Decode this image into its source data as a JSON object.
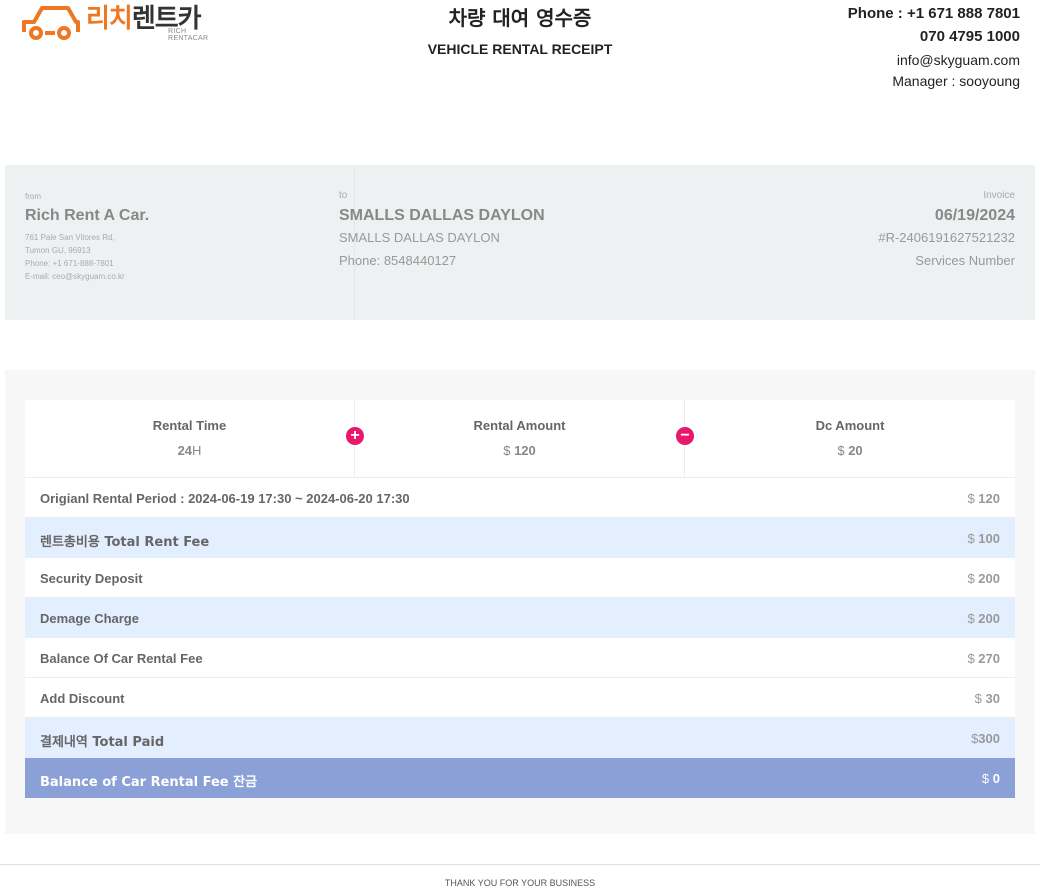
{
  "logo": {
    "ko_part1": "리치",
    "ko_part2": "렌트카",
    "en": "RICH RENTACAR",
    "icon": "car-logo-icon"
  },
  "title": {
    "ko": "차량 대여 영수증",
    "en": "VEHICLE RENTAL RECEIPT"
  },
  "contact": {
    "phone": "Phone : +1 671 888 7801",
    "phone2": "070 4795 1000",
    "email": "info@skyguam.com",
    "manager": "Manager : sooyoung"
  },
  "from": {
    "label": "from",
    "name": "Rich Rent A Car.",
    "address1": "761 Pale San Vitores Rd,",
    "address2": "Tumon GU, 96913",
    "phone": "Phone: +1 671-888-7801",
    "email": "E-mail: ceo@skyguam.co.kr"
  },
  "to": {
    "label": "to",
    "name": "SMALLS DALLAS DAYLON",
    "name2": "SMALLS DALLAS DAYLON",
    "phone": "Phone: 8548440127"
  },
  "invoice": {
    "label": "Invoice",
    "date": "06/19/2024",
    "number": "#R-2406191627521232",
    "services": "Services Number"
  },
  "summary": {
    "rental_time_label": "Rental Time",
    "rental_time_value": "24",
    "rental_time_unit": "H",
    "rental_amount_label": "Rental Amount",
    "rental_amount_currency": "$",
    "rental_amount_value": "120",
    "dc_amount_label": "Dc Amount",
    "dc_amount_currency": "$",
    "dc_amount_value": "20",
    "plus_symbol": "+",
    "minus_symbol": "−"
  },
  "rows": [
    {
      "label": "Origianl Rental Period : 2024-06-19 17:30 ~ 2024-06-20 17:30",
      "currency": "$",
      "amount": "120"
    },
    {
      "label": "렌트총비용 Total Rent Fee",
      "currency": "$",
      "amount": "100"
    },
    {
      "label": "Security Deposit",
      "currency": "$",
      "amount": "200"
    },
    {
      "label": "Demage Charge",
      "currency": "$",
      "amount": "200"
    },
    {
      "label": "Balance Of Car Rental Fee",
      "currency": "$",
      "amount": "270"
    },
    {
      "label": "Add Discount",
      "currency": "$",
      "amount": "30"
    },
    {
      "label": "결제내역 Total Paid",
      "currency": "$",
      "amount": "300"
    },
    {
      "label": "Balance of Car Rental Fee 잔금",
      "currency": "$",
      "amount": "0"
    }
  ],
  "footer": "THANK YOU FOR YOUR BUSINESS",
  "colors": {
    "brand_orange": "#ee7722",
    "accent_pink": "#e8196d",
    "row_blue": "#e3efff",
    "total_row": "#8aa0d6"
  }
}
